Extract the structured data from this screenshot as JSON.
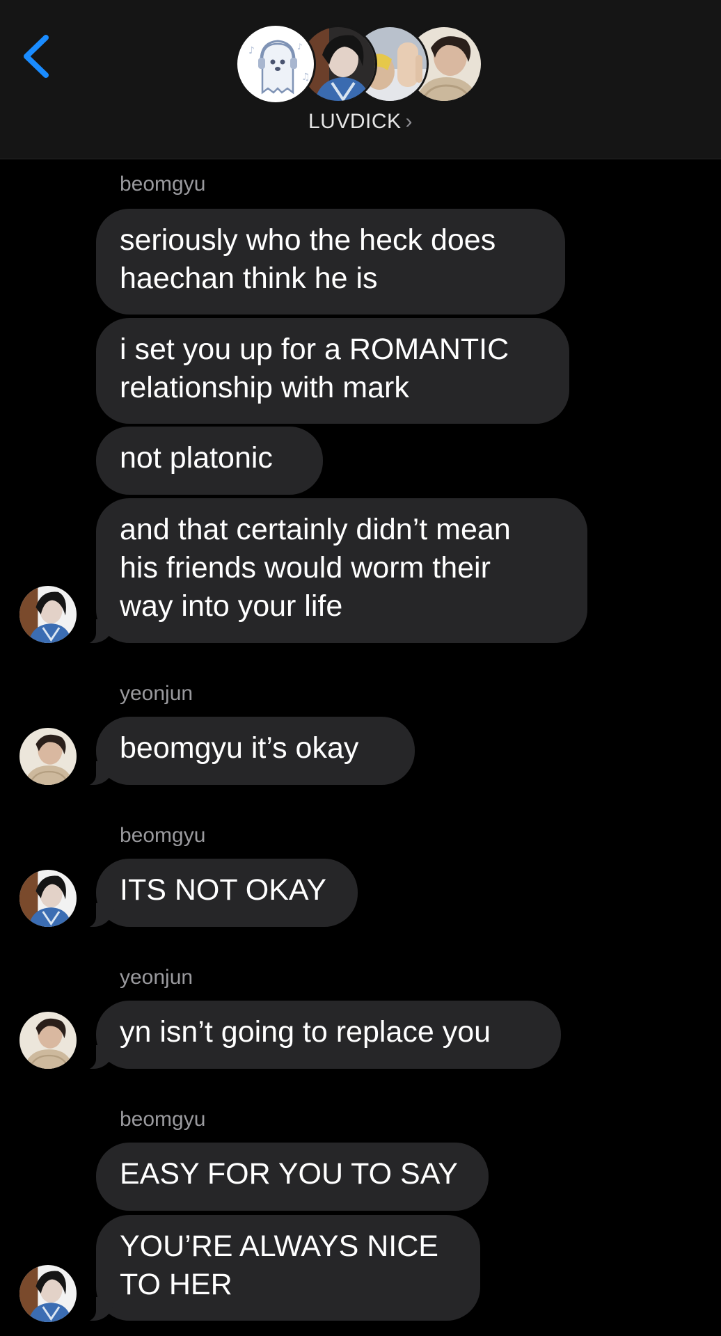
{
  "header": {
    "group_name": "LUVDICK",
    "chevron": "›",
    "back_icon": "chevron-left-icon",
    "accent": "#1a8cff",
    "members": [
      "ghost-avatar",
      "beomgyu-avatar",
      "member-avatar",
      "yeonjun-avatar"
    ]
  },
  "messages": [
    {
      "sender": "beomgyu",
      "lines": [
        "seriously who the heck does",
        "haechan think he is"
      ]
    },
    {
      "lines": [
        "i set you up for a ROMANTIC",
        "relationship with mark"
      ]
    },
    {
      "lines": [
        "not platonic"
      ]
    },
    {
      "lines": [
        "and that certainly didn’t mean",
        "his friends would worm their",
        "way into your life"
      ]
    },
    {
      "sender": "yeonjun",
      "lines": [
        "beomgyu it’s okay"
      ]
    },
    {
      "sender": "beomgyu",
      "lines": [
        "ITS NOT OKAY"
      ]
    },
    {
      "sender": "yeonjun",
      "lines": [
        "yn isn’t going to replace you"
      ]
    },
    {
      "sender": "beomgyu",
      "lines": [
        "EASY FOR YOU TO SAY"
      ]
    },
    {
      "lines": [
        "YOU’RE ALWAYS NICE",
        "TO HER"
      ]
    }
  ],
  "colors": {
    "bubble": "#262628",
    "background": "#000000",
    "header_bg": "#151515",
    "sender_label": "#9a9a9e"
  }
}
